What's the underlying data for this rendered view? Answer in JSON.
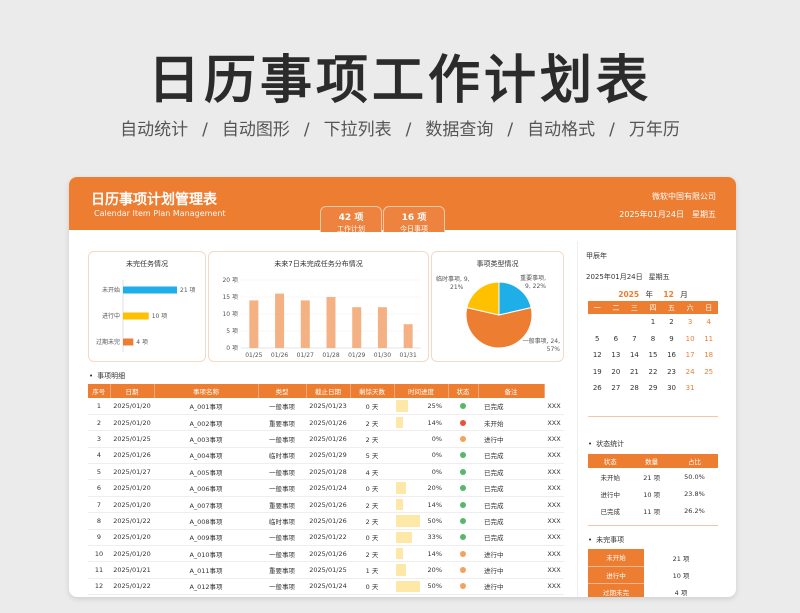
{
  "hero": {
    "title": "日历事项工作计划表",
    "features": [
      "自动统计",
      "自动图形",
      "下拉列表",
      "数据查询",
      "自动格式",
      "万年历"
    ]
  },
  "header": {
    "title": "日历事项计划管理表",
    "subtitle": "Calendar Item Plan Management",
    "company": "微软中国有限公司",
    "date": "2025年01月24日",
    "weekday": "星期五",
    "tabs": [
      {
        "count": "42 项",
        "label": "工作计划"
      },
      {
        "count": "16 项",
        "label": "今日事项"
      }
    ]
  },
  "panels": {
    "unfinished_title": "未完任务情况",
    "week_title": "未来7日未完成任务分布情况",
    "type_title": "事项类型情况"
  },
  "chart_data": [
    {
      "type": "bar",
      "orientation": "horizontal",
      "title": "未完任务情况",
      "categories": [
        "未开始",
        "进行中",
        "过期未完"
      ],
      "values": [
        21,
        10,
        4
      ],
      "value_labels": [
        "21 项",
        "10 项",
        "4 项"
      ],
      "colors": [
        "#1eaee8",
        "#ffc000",
        "#ed7d31"
      ]
    },
    {
      "type": "bar",
      "title": "未来7日未完成任务分布情况",
      "categories": [
        "01/25",
        "01/26",
        "01/27",
        "01/28",
        "01/29",
        "01/30",
        "01/31"
      ],
      "values": [
        14,
        16,
        14,
        15,
        12,
        12,
        7
      ],
      "ylim": [
        0,
        20
      ],
      "yticks": [
        "0 项",
        "5 项",
        "10 项",
        "15 项",
        "20 项"
      ],
      "color": "#f4b183"
    },
    {
      "type": "pie",
      "title": "事项类型情况",
      "slices": [
        {
          "name": "重要事项",
          "value": 9,
          "percent": 22,
          "label_line1": "重要事项,",
          "label_line2": "9, 22%",
          "color": "#1eaee8"
        },
        {
          "name": "一般事项",
          "value": 24,
          "percent": 57,
          "label_line1": "一般事项, 24,",
          "label_line2": "57%",
          "color": "#ed7d31"
        },
        {
          "name": "临时事项",
          "value": 9,
          "percent": 21,
          "label_line1": "临时事项, 9,",
          "label_line2": "21%",
          "color": "#ffc000"
        }
      ]
    }
  ],
  "table": {
    "section": "事项明细",
    "columns": [
      "序号",
      "日期",
      "事项名称",
      "类型",
      "截止日期",
      "剩馀天数",
      "时间进度",
      "状态",
      "备注"
    ],
    "rows": [
      {
        "no": "1",
        "date": "2025/01/20",
        "name": "A_001事项",
        "type": "一般事项",
        "due": "2025/01/23",
        "left": "0 天",
        "progress": 25,
        "progress_label": "25%",
        "status_color": "#57b86a",
        "status": "已完成",
        "note": "XXX"
      },
      {
        "no": "2",
        "date": "2025/01/20",
        "name": "A_002事项",
        "type": "重要事项",
        "due": "2025/01/26",
        "left": "2 天",
        "progress": 14,
        "progress_label": "14%",
        "status_color": "#e5533d",
        "status": "未开始",
        "note": "XXX"
      },
      {
        "no": "3",
        "date": "2025/01/25",
        "name": "A_003事项",
        "type": "一般事项",
        "due": "2025/01/26",
        "left": "2 天",
        "progress": 0,
        "progress_label": "0%",
        "status_color": "#f2a35c",
        "status": "进行中",
        "note": "XXX"
      },
      {
        "no": "4",
        "date": "2025/01/26",
        "name": "A_004事项",
        "type": "临时事项",
        "due": "2025/01/29",
        "left": "5 天",
        "progress": 0,
        "progress_label": "0%",
        "status_color": "#57b86a",
        "status": "已完成",
        "note": "XXX"
      },
      {
        "no": "5",
        "date": "2025/01/27",
        "name": "A_005事项",
        "type": "一般事项",
        "due": "2025/01/28",
        "left": "4 天",
        "progress": 0,
        "progress_label": "0%",
        "status_color": "#57b86a",
        "status": "已完成",
        "note": "XXX"
      },
      {
        "no": "6",
        "date": "2025/01/20",
        "name": "A_006事项",
        "type": "一般事项",
        "due": "2025/01/24",
        "left": "0 天",
        "progress": 20,
        "progress_label": "20%",
        "status_color": "#57b86a",
        "status": "已完成",
        "note": "XXX"
      },
      {
        "no": "7",
        "date": "2025/01/20",
        "name": "A_007事项",
        "type": "重要事项",
        "due": "2025/01/26",
        "left": "2 天",
        "progress": 14,
        "progress_label": "14%",
        "status_color": "#57b86a",
        "status": "已完成",
        "note": "XXX"
      },
      {
        "no": "8",
        "date": "2025/01/22",
        "name": "A_008事项",
        "type": "临时事项",
        "due": "2025/01/26",
        "left": "2 天",
        "progress": 50,
        "progress_label": "50%",
        "status_color": "#57b86a",
        "status": "已完成",
        "note": "XXX"
      },
      {
        "no": "9",
        "date": "2025/01/20",
        "name": "A_009事项",
        "type": "一般事项",
        "due": "2025/01/22",
        "left": "0 天",
        "progress": 33,
        "progress_label": "33%",
        "status_color": "#57b86a",
        "status": "已完成",
        "note": "XXX"
      },
      {
        "no": "10",
        "date": "2025/01/20",
        "name": "A_010事项",
        "type": "一般事项",
        "due": "2025/01/26",
        "left": "2 天",
        "progress": 14,
        "progress_label": "14%",
        "status_color": "#f2a35c",
        "status": "进行中",
        "note": "XXX"
      },
      {
        "no": "11",
        "date": "2025/01/21",
        "name": "A_011事项",
        "type": "重要事项",
        "due": "2025/01/25",
        "left": "1 天",
        "progress": 20,
        "progress_label": "20%",
        "status_color": "#f2a35c",
        "status": "进行中",
        "note": "XXX"
      },
      {
        "no": "12",
        "date": "2025/01/22",
        "name": "A_012事项",
        "type": "一般事项",
        "due": "2025/01/24",
        "left": "0 天",
        "progress": 50,
        "progress_label": "50%",
        "status_color": "#f2a35c",
        "status": "进行中",
        "note": "XXX"
      }
    ]
  },
  "calendar": {
    "lunar": "甲辰年",
    "date": "2025年01月24日",
    "weekday": "星期五",
    "year": "2025",
    "year_suffix": "年",
    "month": "12",
    "month_suffix": "月",
    "weekdays": [
      "一",
      "二",
      "三",
      "四",
      "五",
      "六",
      "日"
    ],
    "weeks": [
      [
        "",
        "",
        "",
        "",
        "",
        "",
        ""
      ],
      [
        "",
        "",
        "",
        "",
        "",
        "",
        ""
      ],
      [
        "",
        "",
        "",
        "",
        "",
        "",
        ""
      ],
      [
        "",
        "",
        "",
        "",
        "",
        "",
        ""
      ],
      [
        "",
        "",
        "",
        "",
        "",
        "",
        ""
      ]
    ],
    "days_flat": [
      "",
      "",
      "",
      "1",
      "2",
      "3",
      "4",
      "5",
      "6",
      "7",
      "8",
      "9",
      "10",
      "11",
      "12",
      "13",
      "14",
      "15",
      "16",
      "17",
      "18",
      "19",
      "20",
      "21",
      "22",
      "23",
      "24",
      "25",
      "26",
      "27",
      "28",
      "29",
      "30",
      "31",
      ""
    ]
  },
  "status_stats": {
    "section": "状态统计",
    "columns": [
      "状态",
      "数量",
      "占比"
    ],
    "rows": [
      {
        "status": "未开始",
        "count": "21 项",
        "ratio": "50.0%"
      },
      {
        "status": "进行中",
        "count": "10 项",
        "ratio": "23.8%"
      },
      {
        "status": "已完成",
        "count": "11 项",
        "ratio": "26.2%"
      }
    ]
  },
  "unfinished": {
    "section": "未完事项",
    "rows": [
      {
        "label": "未开始",
        "value": "21 项"
      },
      {
        "label": "进行中",
        "value": "10 项"
      },
      {
        "label": "过期未完",
        "value": "4 项"
      }
    ]
  }
}
